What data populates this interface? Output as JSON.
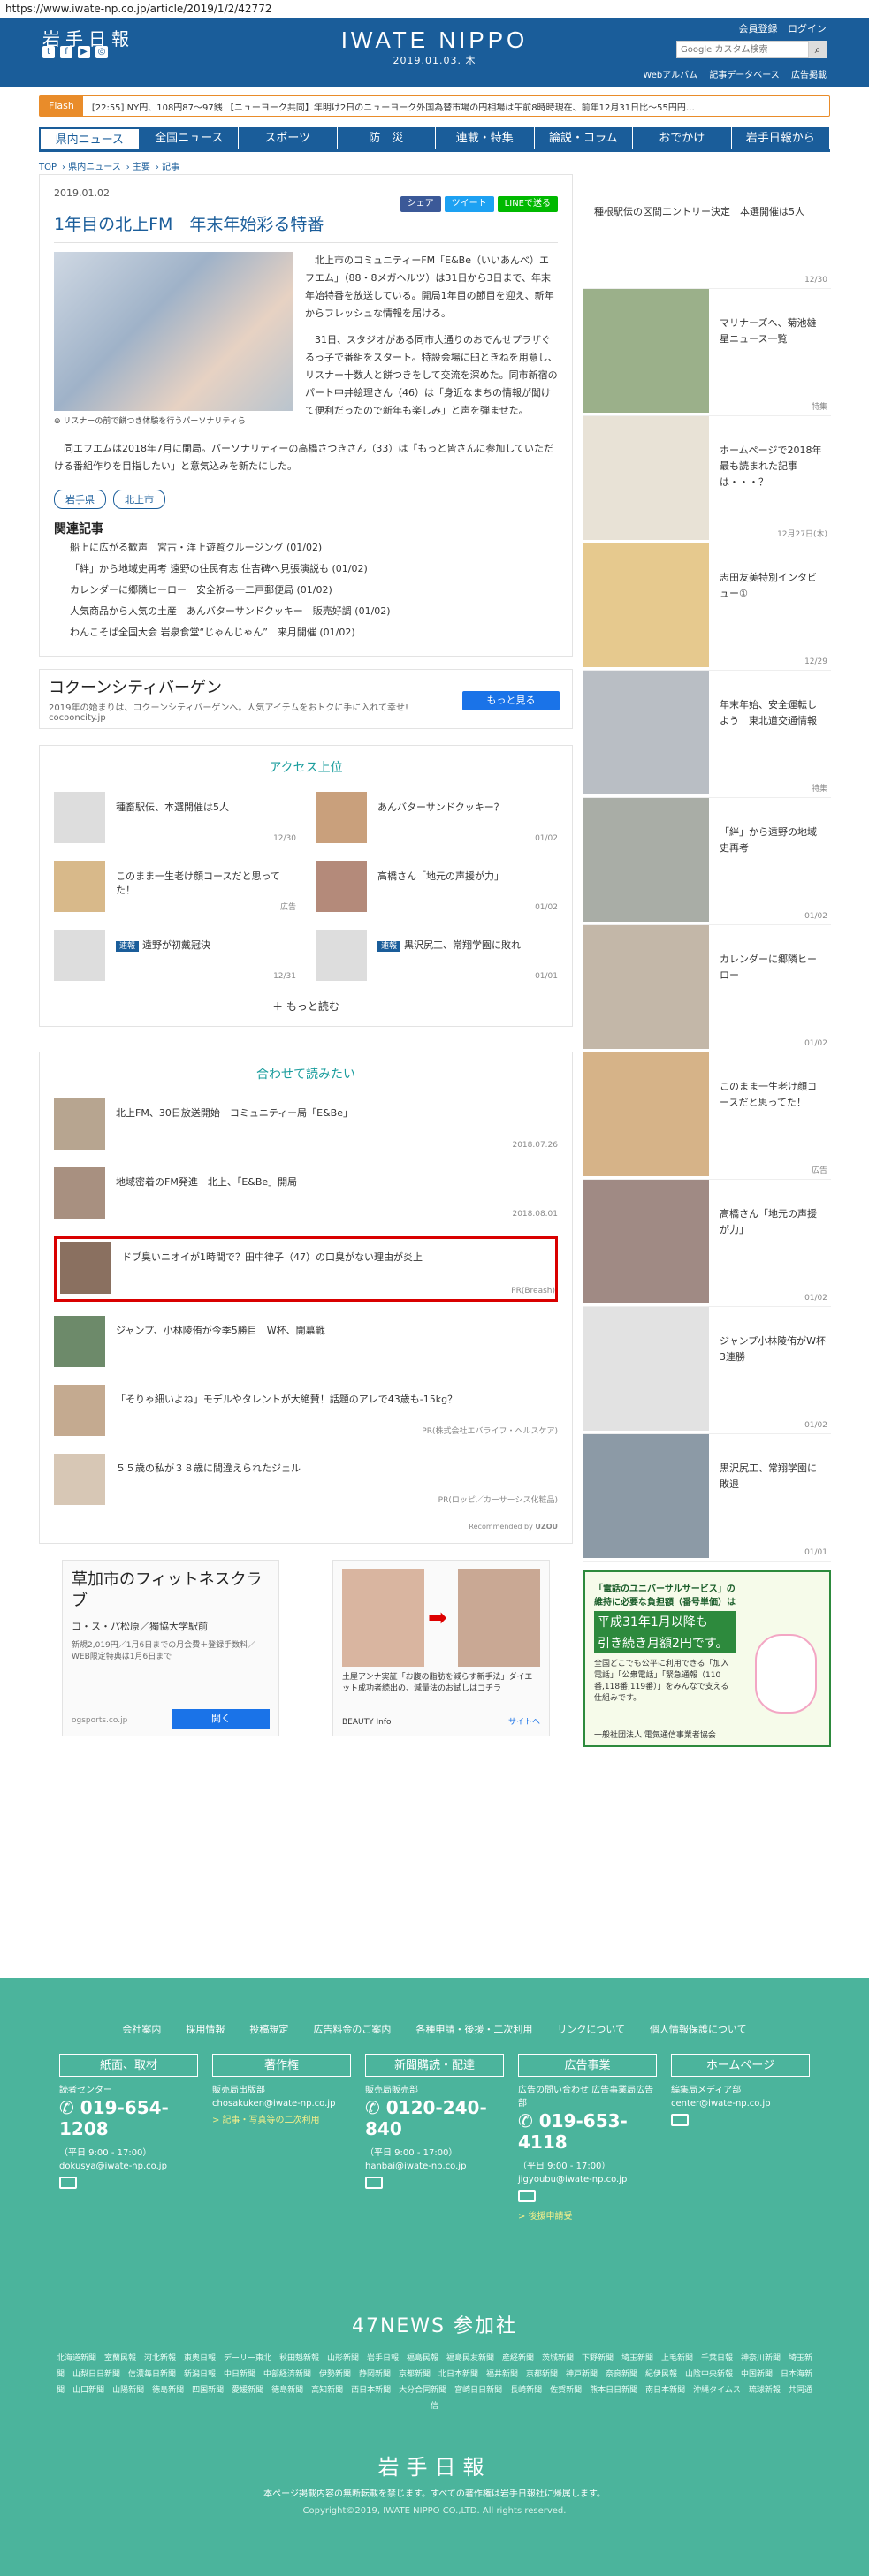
{
  "browser": {
    "url": "https://www.iwate-np.co.jp/article/2019/1/2/42772"
  },
  "header": {
    "logo": "岩手日報",
    "brand": "IWATE NIPPO",
    "date": "2019.01.03. 木",
    "auth": [
      "会員登録",
      "ログイン"
    ],
    "search_placeholder": "Google カスタム検索",
    "sub_links": [
      "Webアルバム",
      "記事データベース",
      "広告掲載"
    ]
  },
  "flash": {
    "label": "Flash",
    "text": "[22:55] NY円、108円87〜97銭 【ニューヨーク共同】年明け2日のニューヨーク外国為替市場の円相場は午前8時時現在、前年12月31日比〜55円円…"
  },
  "nav": [
    "県内ニュース",
    "全国ニュース",
    "スポーツ",
    "防　災",
    "連載・特集",
    "論説・コラム",
    "おでかけ",
    "岩手日報から"
  ],
  "breadcrumb": [
    "TOP",
    "県内ニュース",
    "主要",
    "記事"
  ],
  "article": {
    "date": "2019.01.02",
    "share": [
      "シェア",
      "ツイート",
      "LINEで送る"
    ],
    "title": "1年目の北上FM　年末年始彩る特番",
    "caption": "リスナーの前で餅つき体験を行うパーソナリティら",
    "p1": "北上市のコミュニティーFM「E&Be（いいあんべ）エフエム」（88・8メガヘルツ）は31日から3日まで、年末年始特番を放送している。開局1年目の節目を迎え、新年からフレッシュな情報を届ける。",
    "p2": "31日、スタジオがある同市大通りのおでんせプラザぐるっ子で番組をスタート。特設会場に臼ときねを用意し、リスナー十数人と餅つきをして交流を深めた。同市新宿のパート中井絵理さん（46）は「身近なまちの情報が聞けて便利だったので新年も楽しみ」と声を弾ませた。",
    "p3": "同エフエムは2018年7月に開局。パーソナリティーの高橋さつきさん（33）は「もっと皆さんに参加していただける番組作りを目指したい」と意気込みを新たにした。",
    "tags": [
      "岩手県",
      "北上市"
    ],
    "related_title": "関連記事",
    "related": [
      "船上に広がる歓声　宮古・洋上遊覧クルージング (01/02)",
      "「絆」から地域史再考 遠野の住民有志 住吉碑へ見張演説も (01/02)",
      "カレンダーに郷隣ヒーロー　安全祈る一二戸郵便局 (01/02)",
      "人気商品から人気の土産　あんバターサンドクッキー　販売好調 (01/02)",
      "わんこそば全国大会 岩泉食堂“じゃんじゃん”　来月開催 (01/02)"
    ]
  },
  "ad1": {
    "title": "コクーンシティバーゲン",
    "desc": "2019年の始まりは、コクーンシティバーゲンへ。人気アイテムをおトクに手に入れて幸せ! cocooncity.jp",
    "button": "もっと見る"
  },
  "access": {
    "title": "アクセス上位",
    "items": [
      {
        "text": "種畜駅伝、本選開催は5人",
        "date": "12/30",
        "badge": ""
      },
      {
        "text": "あんバターサンドクッキー？",
        "date": "01/02",
        "badge": ""
      },
      {
        "text": "このまま一生老け顔コースだと思ってた！",
        "date": "広告",
        "badge": ""
      },
      {
        "text": "高橋さん「地元の声援が力」",
        "date": "01/02",
        "badge": ""
      },
      {
        "text": "遠野が初戴冠決",
        "date": "12/31",
        "badge": "速報"
      },
      {
        "text": "黒沢尻工、常翔学園に敗れ",
        "date": "01/01",
        "badge": "速報"
      }
    ],
    "more": "もっと読む"
  },
  "together": {
    "title": "合わせて読みたい",
    "items": [
      {
        "text": "北上FM、30日放送開始　コミュニティー局「E&Be」",
        "meta": "2018.07.26"
      },
      {
        "text": "地域密着のFM発進　北上、「E&Be」開局",
        "meta": "2018.08.01"
      },
      {
        "text": "ドブ臭いニオイが1時間で？田中律子（47）の口臭がない理由が炎上",
        "meta": "PR(Breash)"
      },
      {
        "text": "ジャンプ、小林陵侑が今季5勝目　W杯、開幕戦",
        "meta": ""
      },
      {
        "text": "「そりゃ細いよね」モデルやタレントが大絶賛！話題のアレで43歳も-15kg？",
        "meta": "PR(株式会社エバライフ・ヘルスケア)"
      },
      {
        "text": "５５歳の私が３８歳に間違えられたジェル",
        "meta": "PR(ロッピ／カーサーシス化粧品)"
      }
    ],
    "recommended": "Recommended by"
  },
  "ads2": [
    {
      "title": "草加市のフィットネスクラブ",
      "sub": "コ・ス・パ松原／獨協大学駅前",
      "desc": "新規2,019円／1月6日までの月会費＋登録手数料／WEB限定特典は1月6日まで",
      "domain": "ogsports.co.jp",
      "button": "開く"
    },
    {
      "title": "土屋アンナ実証「お腹の脂肪を減らす新手法」ダイエット成功者続出の、減量法のお試しはコチラ",
      "domain": "BEAUTY Info",
      "button": "サイトへ"
    }
  ],
  "sidebar": {
    "items": [
      {
        "text": "種根駅伝の区間エントリー決定　本選開催は5人",
        "date": "12/30"
      },
      {
        "text": "マリナーズへ、菊池雄星ニュース一覧",
        "date": "特集"
      },
      {
        "text": "ホームページで2018年最も読まれた記事は・・・？",
        "date": "12月27日(木)"
      },
      {
        "text": "志田友美特別インタビュー①",
        "date": "12/29"
      },
      {
        "text": "年末年始、安全運転しよう　東北道交通情報",
        "date": "特集"
      },
      {
        "text": "「絆」から遠野の地域史再考",
        "date": "01/02"
      },
      {
        "text": "カレンダーに郷隣ヒーロー",
        "date": "01/02"
      },
      {
        "text": "このまま一生老け顔コースだと思ってた！",
        "date": "広告"
      },
      {
        "text": "高橋さん「地元の声援が力」",
        "date": "01/02"
      },
      {
        "text": "ジャンプ小林陵侑がW杯3連勝",
        "date": "01/02"
      },
      {
        "text": "黒沢尻工、常翔学園に敗退",
        "date": "01/01"
      }
    ],
    "ad": {
      "line1": "「電話のユニバーサルサービス」の",
      "line2": "維持に必要な負担額（番号単価）は",
      "line3": "平成31年1月以降も",
      "line4": "引き続き月額2円です。",
      "line5": "全国どこでも公平に利用できる「加入電話」「公衆電話」「緊急通報（110番,118番,119番）」をみんなで支える仕組みです。",
      "org": "一般社団法人 電気通信事業者協会"
    }
  },
  "footer": {
    "nav": [
      "会社案内",
      "採用情報",
      "投稿規定",
      "広告料金のご案内",
      "各種申請・後援・二次利用",
      "リンクについて",
      "個人情報保護について"
    ],
    "cols": [
      {
        "head": "紙面、取材",
        "sub": "読者センター",
        "num": "019-654-1208",
        "hours": "（平日 9:00 - 17:00）",
        "email": "dokusya@iwate-np.co.jp"
      },
      {
        "head": "著作権",
        "sub": "販売局出版部",
        "num": "",
        "hours": "",
        "email": "chosakuken@iwate-np.co.jp",
        "link": "> 記事・写真等の二次利用"
      },
      {
        "head": "新聞購読・配達",
        "sub": "販売局販売部",
        "num": "0120-240-840",
        "hours": "（平日 9:00 - 17:00）",
        "email": "hanbai@iwate-np.co.jp"
      },
      {
        "head": "広告事業",
        "sub": "広告の問い合わせ 広告事業局広告部",
        "num": "019-653-4118",
        "hours": "（平日 9:00 - 17:00）",
        "email": "jigyoubu@iwate-np.co.jp",
        "link": "> 後援申請受"
      },
      {
        "head": "ホームページ",
        "sub": "編集局メディア部",
        "num": "",
        "hours": "",
        "email": "center@iwate-np.co.jp"
      }
    ],
    "news47": "47NEWS 参加社",
    "members": "北海道新聞　室蘭民報　河北新報　東奥日報　デーリー東北　秋田魁新報　山形新聞　岩手日報　福島民報　福島民友新聞　産経新聞　茨城新聞　下野新聞　埼玉新聞　上毛新聞　千葉日報　神奈川新聞　埼玉新聞　山梨日日新聞　信濃毎日新聞　新潟日報　中日新聞　中部経済新聞　伊勢新聞　静岡新聞　京都新聞　北日本新聞　福井新聞　京都新聞　神戸新聞　奈良新聞　紀伊民報　山陰中央新報　中国新聞　日本海新聞　山口新聞　山陽新聞　徳島新聞　四国新聞　愛媛新聞　徳島新聞　高知新聞　西日本新聞　大分合同新聞　宮崎日日新聞　長崎新聞　佐賀新聞　熊本日日新聞　南日本新聞　沖縄タイムス　琉球新報　共同通信",
    "logo": "岩手日報",
    "note": "本ページ掲載内容の無断転載を禁じます。すべての著作権は岩手日報社に帰属します。",
    "copy": "Copyright©2019, IWATE NIPPO CO.,LTD. All rights reserved."
  }
}
